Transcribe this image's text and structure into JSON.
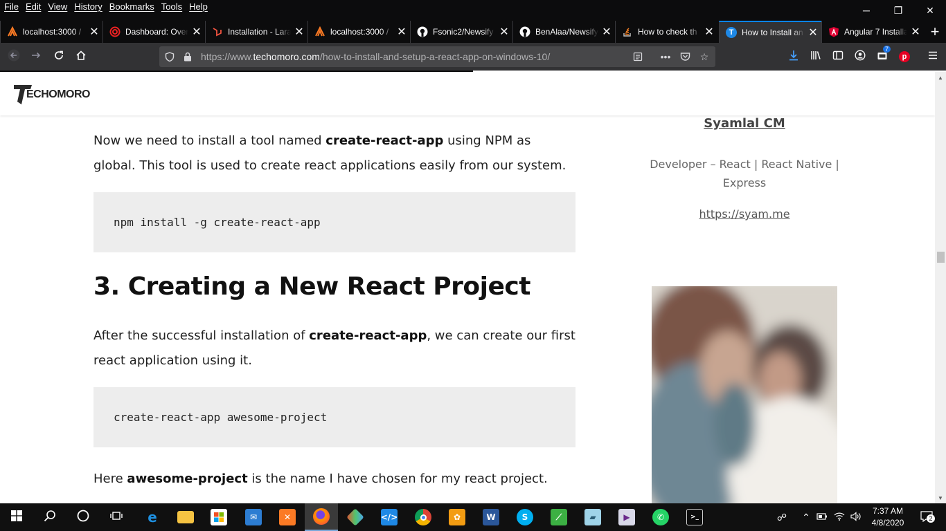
{
  "menubar": {
    "items": [
      "File",
      "Edit",
      "View",
      "History",
      "Bookmarks",
      "Tools",
      "Help"
    ]
  },
  "window_controls": {
    "minimize": "─",
    "restore": "❐",
    "close": "✕"
  },
  "tabs": [
    {
      "title": "localhost:3000 /",
      "icon": "xampp-icon"
    },
    {
      "title": "Dashboard: Over",
      "icon": "target-icon"
    },
    {
      "title": "Installation - Lara",
      "icon": "laravel-icon"
    },
    {
      "title": "localhost:3000 /",
      "icon": "xampp-icon"
    },
    {
      "title": "Fsonic2/Newsify",
      "icon": "github-icon"
    },
    {
      "title": "BenAlaa/Newsify",
      "icon": "github-icon"
    },
    {
      "title": "How to check th",
      "icon": "stackoverflow-icon"
    },
    {
      "title": "How to Install an",
      "icon": "techomoro-icon",
      "active": true
    },
    {
      "title": "Angular 7 Installa",
      "icon": "angular-icon"
    }
  ],
  "newtab": "+",
  "urlbar": {
    "prefix": "https://www.",
    "domain": "techomoro.com",
    "path": "/how-to-install-and-setup-a-react-app-on-windows-10/"
  },
  "toolbar": {
    "notification_badge": "7"
  },
  "site": {
    "logo_text": "ECHOMORO"
  },
  "article": {
    "p1_a": "Now we need to install a tool named ",
    "p1_b": "create-react-app",
    "p1_c": " using NPM as global. This tool is used to create react applications easily from our system.",
    "code1": "npm install -g create-react-app",
    "heading": "3. Creating a New React Project",
    "p2_a": "After the successful installation of ",
    "p2_b": "create-react-app",
    "p2_c": ", we can create our first react application using it.",
    "code2": "create-react-app awesome-project",
    "p3_a": "Here ",
    "p3_b": "awesome-project",
    "p3_c": " is the name I have chosen for my react project."
  },
  "sidebar": {
    "author": "Syamlal CM",
    "role": "Developer – React | React Native | Express",
    "website": "https://syam.me"
  },
  "taskbar": {
    "time": "7:37 AM",
    "date": "4/8/2020",
    "notifications": "2"
  },
  "colors": {
    "chrome_dark": "#0c0c0d",
    "toolbar": "#323234",
    "urlbar": "#474749",
    "accent": "#0a84ff",
    "code_bg": "#ededed"
  }
}
